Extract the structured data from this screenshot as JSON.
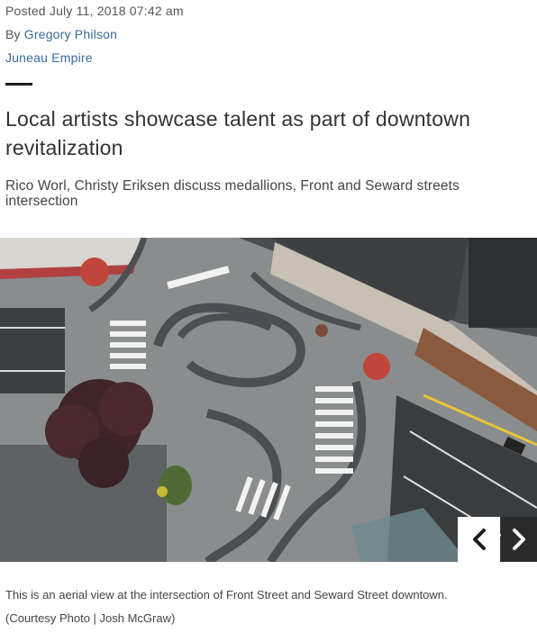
{
  "article": {
    "posted": "Posted July 11, 2018 07:42 am",
    "by_label": "By",
    "author": "Gregory Philson",
    "publication": "Juneau Empire",
    "headline": "Local artists showcase talent as part of downtown revitalization",
    "subhead": "Rico Worl, Christy Eriksen discuss medallions, Front and Seward streets intersection"
  },
  "photo": {
    "description_icon": "aerial-intersection-photo",
    "caption": "This is an aerial view at the intersection of Front Street and Seward Street downtown.",
    "credit": "(Courtesy Photo | Josh McGraw)"
  },
  "gallery_nav": {
    "prev_icon": "chevron-left-icon",
    "next_icon": "chevron-right-icon"
  }
}
